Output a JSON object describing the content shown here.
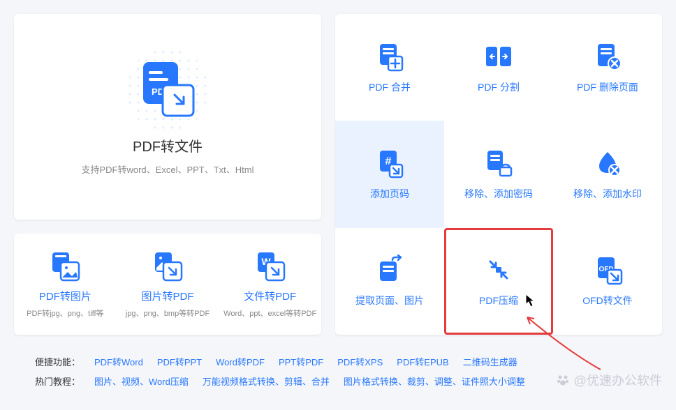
{
  "main_card": {
    "title": "PDF转文件",
    "subtitle": "支持PDF转word、Excel、PPT、Txt、Html"
  },
  "three_card": [
    {
      "title": "PDF转图片",
      "subtitle": "PDF转jpg、png、tiff等"
    },
    {
      "title": "图片转PDF",
      "subtitle": "jpg、png、bmp等转PDF"
    },
    {
      "title": "文件转PDF",
      "subtitle": "Word、ppt、excel等转PDF"
    }
  ],
  "grid": [
    {
      "label": "PDF 合并"
    },
    {
      "label": "PDF 分割"
    },
    {
      "label": "PDF 删除页面"
    },
    {
      "label": "添加页码"
    },
    {
      "label": "移除、添加密码"
    },
    {
      "label": "移除、添加水印"
    },
    {
      "label": "提取页面、图片"
    },
    {
      "label": "PDF压缩"
    },
    {
      "label": "OFD转文件"
    }
  ],
  "quick_links": {
    "label": "便捷功能：",
    "items": [
      "PDF转Word",
      "PDF转PPT",
      "Word转PDF",
      "PPT转PDF",
      "PDF转XPS",
      "PDF转EPUB",
      "二维码生成器"
    ]
  },
  "hot_tutorials": {
    "label": "热门教程：",
    "items": [
      "图片、视频、Word压缩",
      "万能视频格式转换、剪辑、合并",
      "图片格式转换、裁剪、调整、证件照大小调整"
    ]
  },
  "watermark": "@优速办公软件"
}
